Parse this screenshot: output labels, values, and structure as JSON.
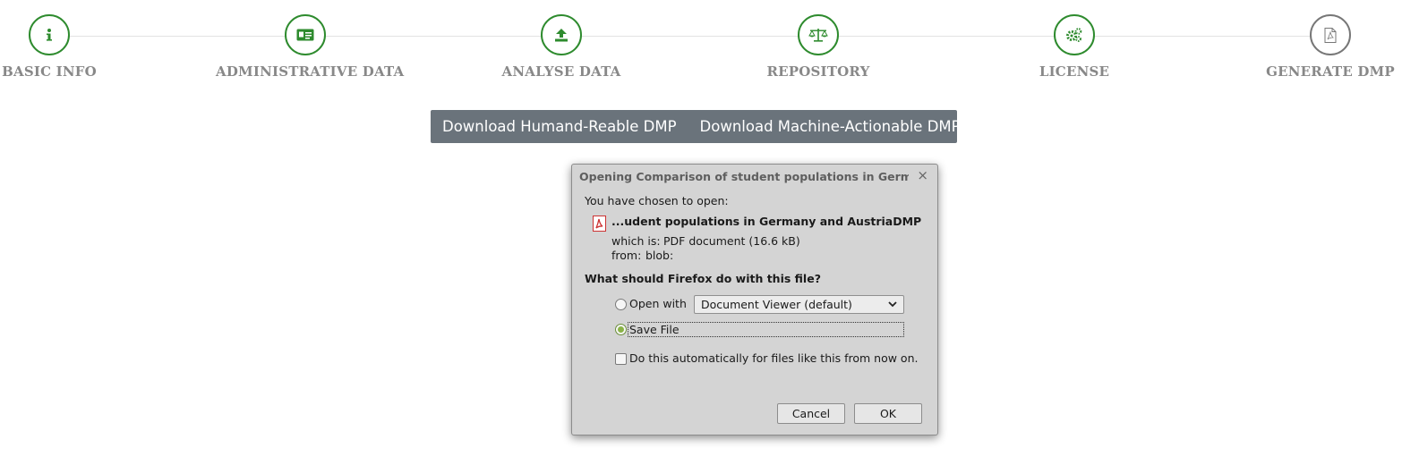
{
  "steps": [
    {
      "label": "BASIC INFO",
      "icon": "info-icon"
    },
    {
      "label": "ADMINISTRATIVE DATA",
      "icon": "id-card-icon"
    },
    {
      "label": "ANALYSE DATA",
      "icon": "upload-icon"
    },
    {
      "label": "REPOSITORY",
      "icon": "balance-scale-icon"
    },
    {
      "label": "LICENSE",
      "icon": "cogs-icon"
    },
    {
      "label": "GENERATE DMP",
      "icon": "pdf-file-icon"
    }
  ],
  "colors": {
    "step_done": "#2e8b2e",
    "step_pending": "#777777",
    "download_bar": "#6a737b"
  },
  "downloads": {
    "human": "Download Humand-Reable DMP",
    "machine": "Download Machine-Actionable DMP"
  },
  "dialog": {
    "title": "Opening Comparison of student populations in Germa...",
    "close": "×",
    "chosen_to_open": "You have chosen to open:",
    "file_name": "...udent populations in Germany and AustriaDMP",
    "which_is_label": "which is:",
    "which_is_value": "PDF document (16.6 kB)",
    "from_label": "from:",
    "from_value": "blob:",
    "question": "What should Firefox do with this file?",
    "open_with_label": "Open with",
    "open_with_value": "Document Viewer (default)",
    "save_file_label": "Save File",
    "save_file_selected": true,
    "auto_label": "Do this automatically for files like this from now on.",
    "cancel": "Cancel",
    "ok": "OK"
  }
}
